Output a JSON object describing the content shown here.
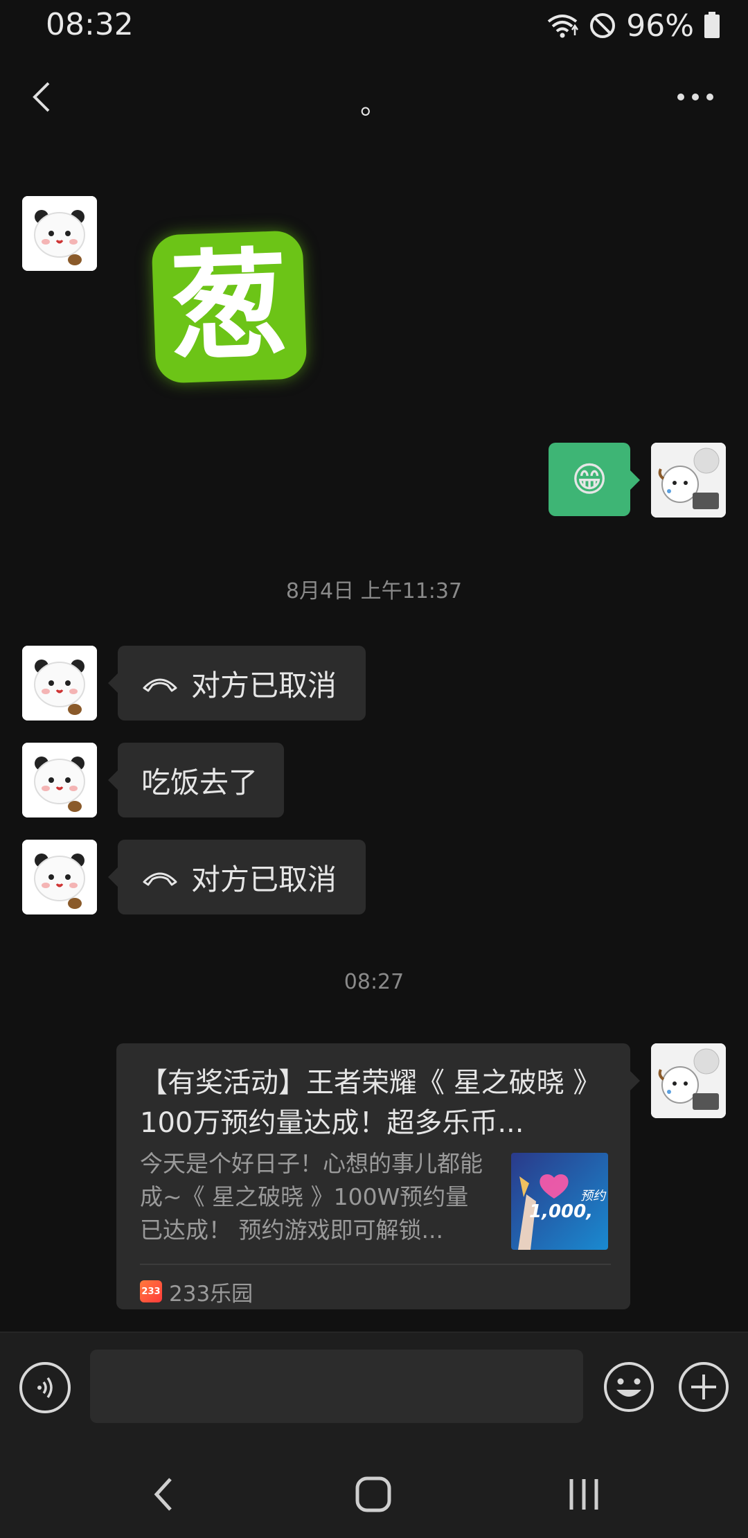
{
  "status_bar": {
    "time": "08:32",
    "battery_percent": "96%",
    "icons": [
      "wifi-icon",
      "do-not-disturb-icon",
      "battery-icon"
    ]
  },
  "header": {
    "title": "。",
    "back_icon": "back-arrow-icon",
    "more_icon": "more-dots-icon"
  },
  "messages": [
    {
      "sender": "other",
      "type": "sticker",
      "sticker_text": "葱"
    },
    {
      "sender": "self",
      "type": "emoji",
      "emoji": "😁"
    },
    {
      "type": "timestamp",
      "text": "8月4日 上午11:37"
    },
    {
      "sender": "other",
      "type": "call",
      "icon": "phone-hangup-icon",
      "text": "对方已取消"
    },
    {
      "sender": "other",
      "type": "text",
      "text": "吃饭去了"
    },
    {
      "sender": "other",
      "type": "call",
      "icon": "phone-hangup-icon",
      "text": "对方已取消"
    },
    {
      "type": "timestamp",
      "text": "08:27"
    },
    {
      "sender": "self",
      "type": "link_card",
      "title": "【有奖活动】王者荣耀《 星之破晓 》100万预约量达成！超多乐币...",
      "description": "今天是个好日子！心想的事儿都能成~《 星之破晓 》100W预约量已达成！ 预约游戏即可解锁...",
      "thumbnail_text": "1,000,",
      "thumbnail_tag": "预约",
      "source_logo_text": "233",
      "source": "233乐园"
    }
  ],
  "input_bar": {
    "value": "",
    "placeholder": "",
    "voice_icon": "voice-icon",
    "emoji_icon": "emoji-icon",
    "plus_icon": "plus-icon"
  },
  "nav_bar": {
    "buttons": [
      "nav-back-icon",
      "nav-home-icon",
      "nav-recents-icon"
    ]
  },
  "colors": {
    "background": "#111111",
    "bubble_other": "#2c2c2c",
    "bubble_self": "#3eb575",
    "sticker_green": "#6cc417"
  }
}
